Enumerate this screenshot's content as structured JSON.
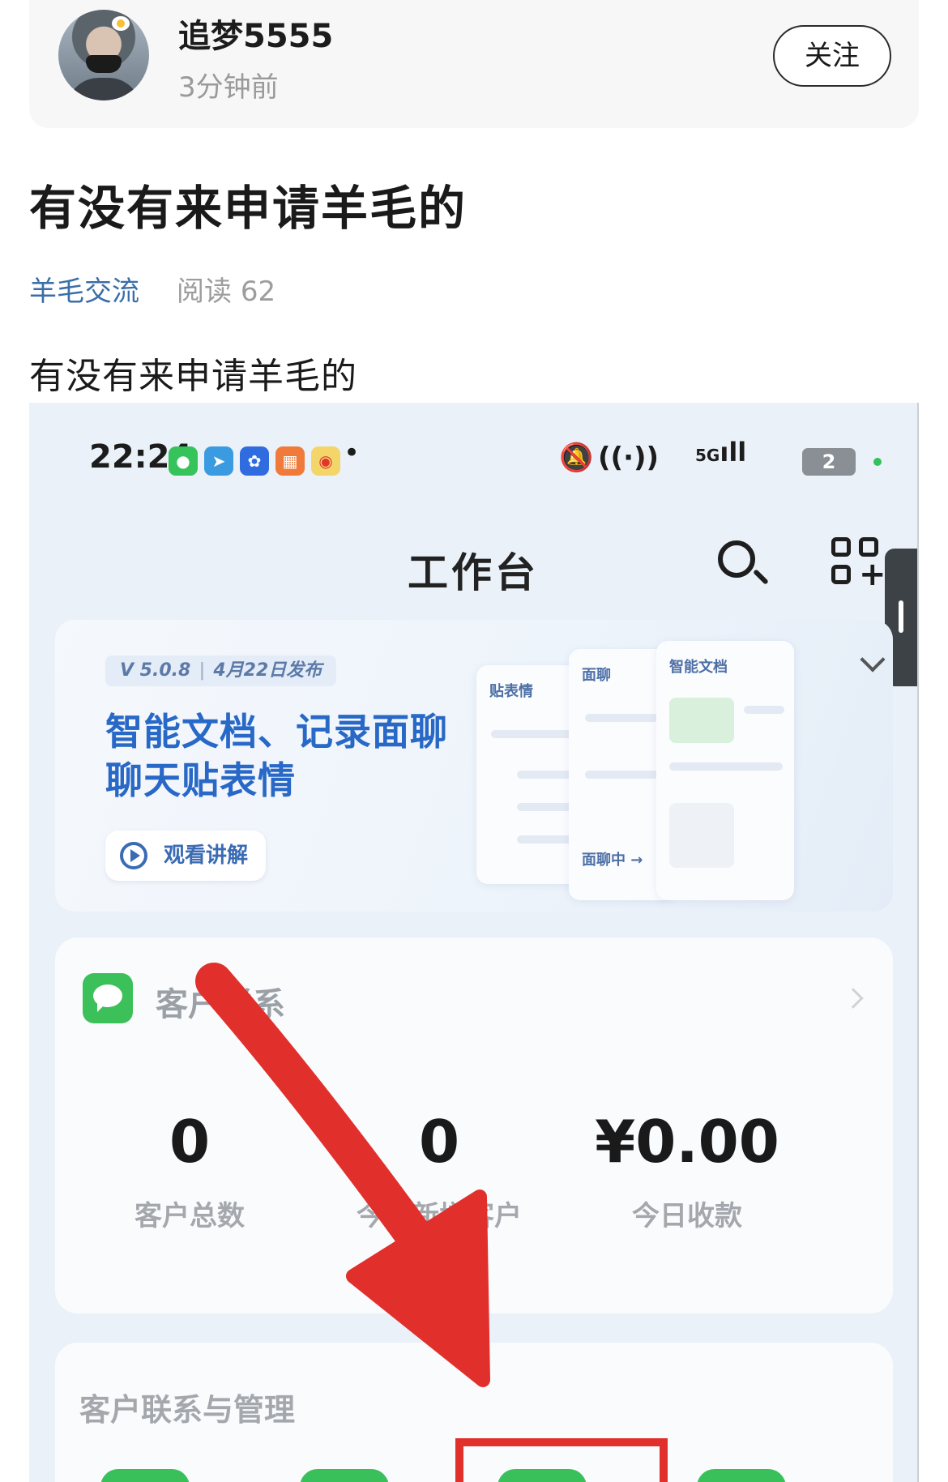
{
  "post": {
    "author": "追梦5555",
    "time": "3分钟前",
    "follow_label": "关注",
    "title": "有没有来申请羊毛的",
    "category": "羊毛交流",
    "reads_label": "阅读",
    "reads_count": "62",
    "body": "有没有来申请羊毛的"
  },
  "screenshot": {
    "status": {
      "time": "22:24",
      "signal_label": "5G",
      "battery": "2"
    },
    "app_title": "工作台",
    "banner": {
      "version": "V 5.0.8",
      "date": "4月22日发布",
      "headline_line1": "智能文档、记录面聊",
      "headline_line2": "聊天贴表情",
      "watch_label": "观看讲解",
      "card1_title": "贴表情",
      "card2_title": "面聊",
      "card3_title": "智能文档",
      "card2_footer": "面聊中 →"
    },
    "contact": {
      "title": "客户联系",
      "stats": [
        {
          "value": "0",
          "label": "客户总数"
        },
        {
          "value": "0",
          "label": "今日新增客户"
        },
        {
          "value": "¥0.00",
          "label": "今日收款"
        }
      ]
    },
    "management_title": "客户联系与管理"
  },
  "colors": {
    "accent_blue": "#2868c6",
    "wechat_green": "#3cc05a",
    "annotation_red": "#e1302c",
    "category_link": "#3a6ea8"
  },
  "icons": [
    "search-icon",
    "apps-add-icon",
    "wechat-icon",
    "play-icon",
    "chevron-right-icon",
    "chevron-down-icon",
    "bell-muted-icon",
    "wifi-icon",
    "signal-icon",
    "battery-icon"
  ]
}
